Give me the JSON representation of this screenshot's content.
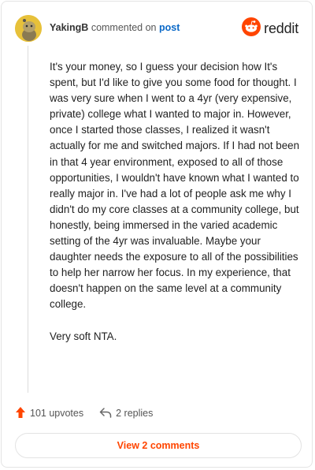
{
  "header": {
    "author": "YakingB",
    "commented_on": "commented on",
    "post_link": "post",
    "logo_text": "reddit",
    "logo_icon": "reddit-logo-icon",
    "avatar_icon": "snoo-avatar-icon"
  },
  "comment": {
    "paragraphs": [
      "It's your money, so I guess your decision how It's spent, but I'd like to give you some food for thought. I was very sure when I went to a 4yr (very expensive, private) college what I wanted to major in. However, once I started those classes, I realized it wasn't actually for me and switched majors. If I had not been in that 4 year environment, exposed to all of those opportunities, I wouldn't have known what I wanted to really major in. I've had a lot of people ask me why I didn't do my core classes at a community college, but honestly, being immersed in the varied academic setting of the 4yr was invaluable. Maybe your daughter needs the exposure to all of the possibilities to help her narrow her focus. In my experience, that doesn't happen on the same level at a community college.",
      "Very soft NTA."
    ]
  },
  "actions": {
    "upvotes": "101 upvotes",
    "replies": "2 replies",
    "upvote_icon": "upvote-arrow-icon",
    "reply_icon": "reply-arrow-icon"
  },
  "footer": {
    "view_comments": "View 2 comments"
  },
  "colors": {
    "accent": "#ff4500",
    "link": "#0b69c8",
    "avatar": "#e7c13a"
  }
}
